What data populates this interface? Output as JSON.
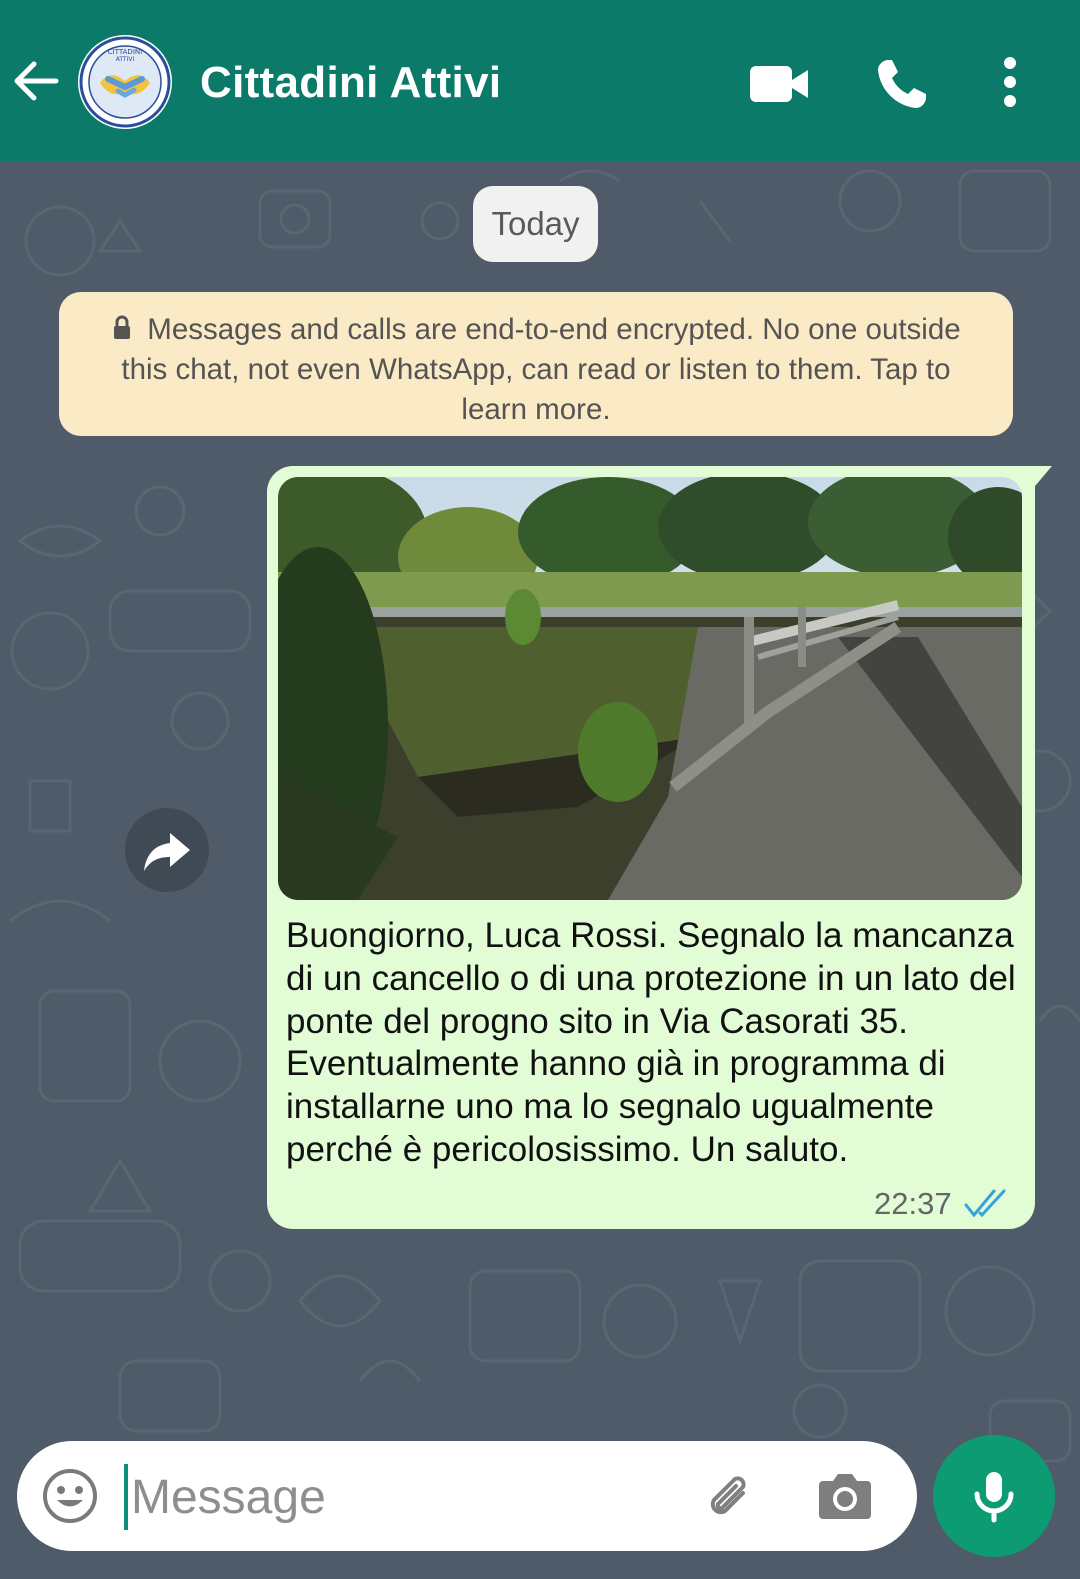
{
  "header": {
    "title": "Cittadini Attivi",
    "avatar_text_top": "CITTADINI ATTIVI",
    "avatar_text_bottom": "INTESA COMUNE",
    "icons": [
      "back-arrow-icon",
      "video-call-icon",
      "phone-icon",
      "more-vert-icon"
    ]
  },
  "chat": {
    "date_chip": "Today",
    "encryption_notice": "Messages and calls are end-to-end encrypted. No one outside this chat, not even WhatsApp, can read or listen to them. Tap to learn more.",
    "message": {
      "text": "Buongiorno, Luca Rossi. Segnalo la mancanza di un cancello o di una protezione in un lato del ponte del progno sito in Via Casorati 35. Eventualmente hanno già in programma di installarne uno ma lo segnalo ugualmente perché è pericolosissimo. Un saluto.",
      "time": "22:37",
      "status": "read",
      "tick_color": "#34a3dd",
      "bubble_color": "#e2fcd6"
    }
  },
  "composer": {
    "placeholder": "Message",
    "icons": [
      "emoji-icon",
      "attach-icon",
      "camera-icon",
      "mic-icon"
    ]
  },
  "colors": {
    "header": "#0b7a68",
    "wallpaper": "#4f5b68",
    "mic_button": "#0d9b74"
  }
}
